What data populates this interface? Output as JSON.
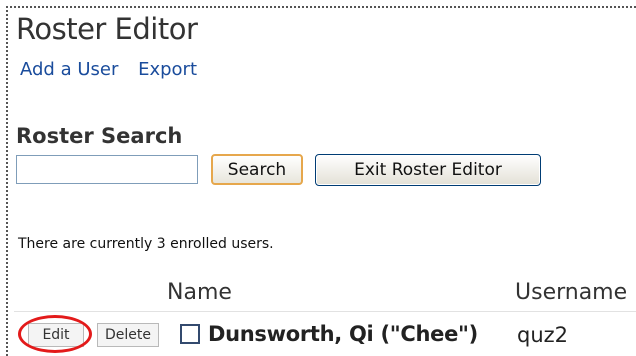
{
  "page": {
    "title": "Roster Editor",
    "links": {
      "add_user": "Add a User",
      "export": "Export"
    }
  },
  "search": {
    "heading": "Roster Search",
    "input_value": "",
    "search_label": "Search",
    "exit_label": "Exit Roster Editor"
  },
  "roster": {
    "enrolled_text": "There are currently 3 enrolled users.",
    "columns": {
      "name": "Name",
      "username": "Username"
    },
    "rows": [
      {
        "edit_label": "Edit",
        "delete_label": "Delete",
        "name": "Dunsworth, Qi (\"Chee\")",
        "username": "quz2",
        "checked": false
      }
    ]
  },
  "colors": {
    "link": "#1a4c9c",
    "highlight_circle": "#e31a1a",
    "search_button_border": "#e6a74c"
  }
}
